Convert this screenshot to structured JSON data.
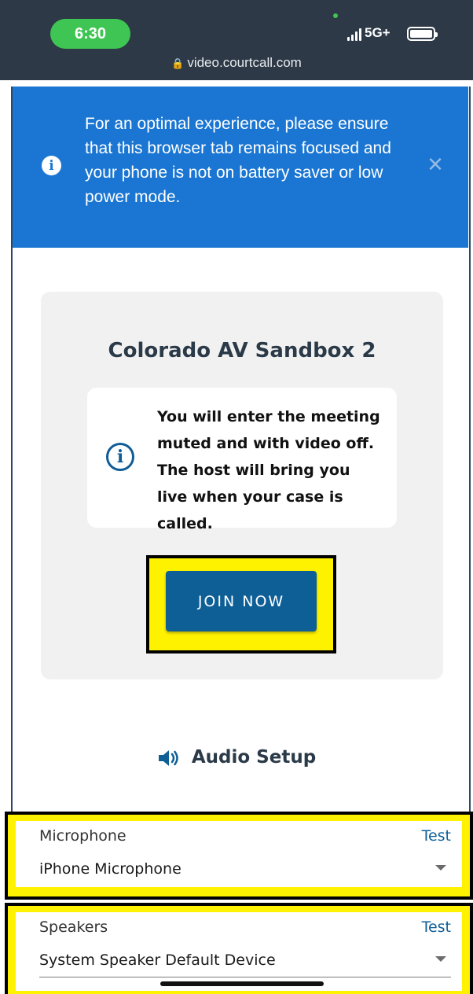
{
  "status_bar": {
    "time": "6:30",
    "network": "5G+",
    "url": "video.courtcall.com"
  },
  "banner": {
    "message": "For an optimal experience, please ensure that this browser tab remains focused and your phone is not on battery saver or low power mode.",
    "info_icon": "info-circle-icon",
    "close_icon": "close-icon",
    "color": "#1a76d2"
  },
  "meeting": {
    "title": "Colorado AV Sandbox 2",
    "notice": "You will enter the meeting muted and with video off. The host will bring you live when your case is called.",
    "join_label": "JOIN NOW"
  },
  "audio_setup": {
    "title": "Audio Setup",
    "microphone": {
      "label": "Microphone",
      "test_label": "Test",
      "selected": "iPhone Microphone"
    },
    "speakers": {
      "label": "Speakers",
      "test_label": "Test",
      "selected": "System Speaker Default Device"
    }
  },
  "colors": {
    "accent": "#0f5f97",
    "highlight": "#fff200",
    "status_bar": "#2d3946"
  }
}
